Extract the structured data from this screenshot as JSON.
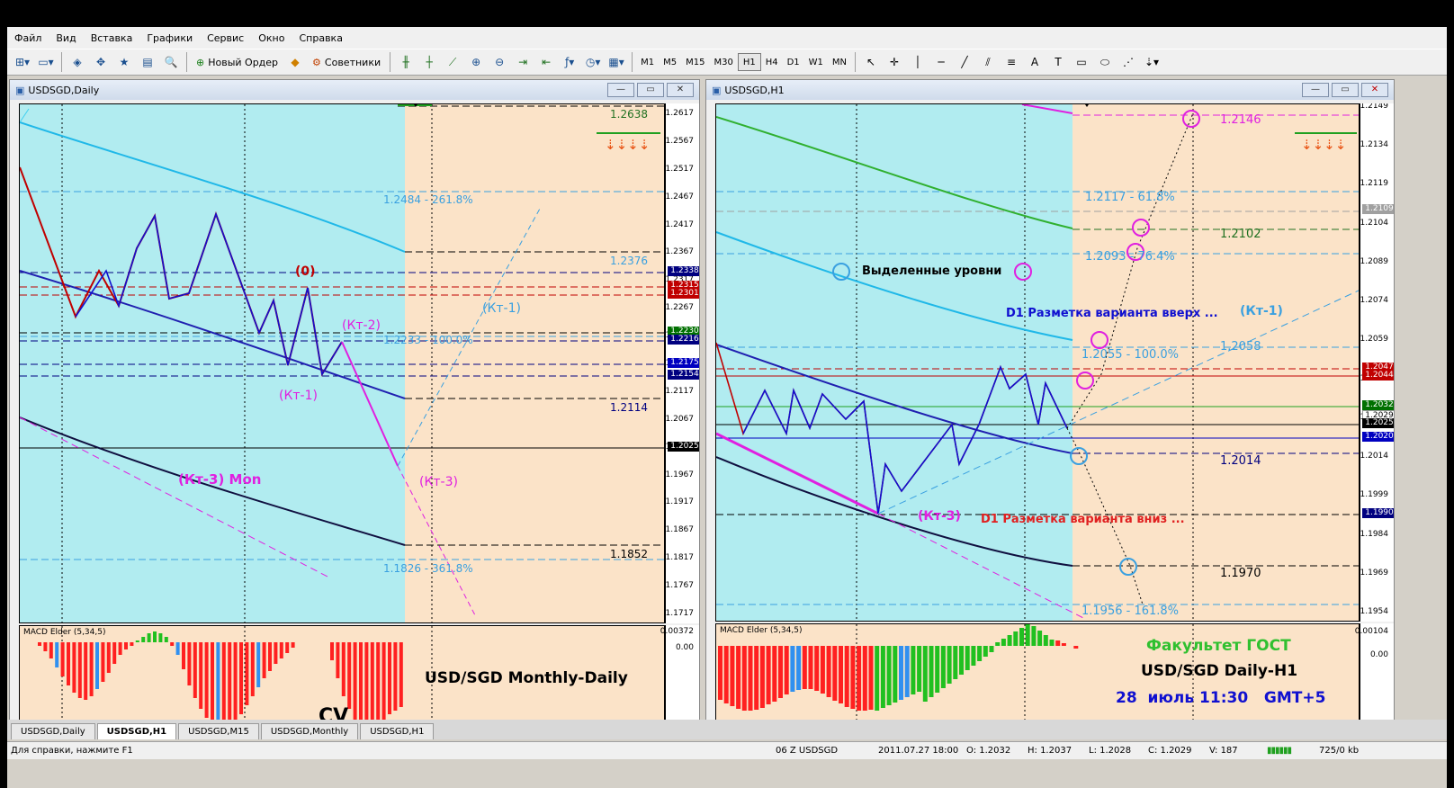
{
  "menu": [
    "Файл",
    "Вид",
    "Вставка",
    "Графики",
    "Сервис",
    "Окно",
    "Справка"
  ],
  "toolbar": {
    "new_order": "Новый Ордер",
    "experts": "Советники",
    "timeframes": [
      "M1",
      "M5",
      "M15",
      "M30",
      "H1",
      "H4",
      "D1",
      "W1",
      "MN"
    ],
    "active_timeframe": "H1"
  },
  "left_chart": {
    "title": "USDSGD,Daily",
    "price_ticks": [
      "1.2617",
      "1.2567",
      "1.2517",
      "1.2467",
      "1.2417",
      "1.2367",
      "1.2317",
      "1.2267",
      "1.2217",
      "1.2167",
      "1.2117",
      "1.2067",
      "1.2017",
      "1.1967",
      "1.1917",
      "1.1867",
      "1.1817",
      "1.1767",
      "1.1717"
    ],
    "price_tags": [
      {
        "text": "1.2338",
        "color": "#000080"
      },
      {
        "text": "1.2315",
        "color": "#c00000"
      },
      {
        "text": "1.2301",
        "color": "#c00000"
      },
      {
        "text": "1.2230",
        "color": "#007000"
      },
      {
        "text": "1.2216",
        "color": "#000080"
      },
      {
        "text": "1.2175",
        "color": "#0000c0"
      },
      {
        "text": "1.2154",
        "color": "#000080"
      },
      {
        "text": "1.2025",
        "color": "#000000"
      }
    ],
    "level_labels": {
      "l_2638": "1.2638",
      "l_2484": "1.2484 - 261.8%",
      "l_2376": "1.2376",
      "l_2233": "1.2233 - 100.0%",
      "l_2114": "1.2114",
      "l_1852": "1.1852",
      "l_1826": "1.1826 - 361.8%"
    },
    "annotations": {
      "zero": "(0)",
      "kt2": "(Кт-2)",
      "kt1_low": "(Кт-1)",
      "kt1_up": "(Кт-1)",
      "kt3": "(Кт-3)",
      "kt3_mon": "(Кт-3) Mon"
    },
    "macd_label": "MACD Elder (5,34,5)",
    "macd_ticks": [
      "0.00372",
      "0.00"
    ],
    "caption": "USD/SGD Monthly-Daily",
    "cv": "CV"
  },
  "right_chart": {
    "title": "USDSGD,H1",
    "price_ticks": [
      "1.2149",
      "1.2134",
      "1.2119",
      "1.2104",
      "1.2089",
      "1.2074",
      "1.2059",
      "1.2044",
      "1.2029",
      "1.2014",
      "1.1999",
      "1.1984",
      "1.1969",
      "1.1954"
    ],
    "price_tags": [
      {
        "text": "1.2109",
        "color": "#a0a0a0"
      },
      {
        "text": "1.2047",
        "color": "#c00000"
      },
      {
        "text": "1.2044",
        "color": "#c00000"
      },
      {
        "text": "1.2032",
        "color": "#007000"
      },
      {
        "text": "1.2029",
        "color": "#ffffff"
      },
      {
        "text": "1.2025",
        "color": "#000000"
      },
      {
        "text": "1.2020",
        "color": "#0000c0"
      },
      {
        "text": "1.1990",
        "color": "#000080"
      }
    ],
    "level_labels": {
      "l_2146": "1.2146",
      "l_2117": "1.2117 - 61.8%",
      "l_2102": "1.2102",
      "l_2093": "1.2093 - 76.4%",
      "l_2058": "1.2058",
      "l_2055": "1.2055 - 100.0%",
      "l_2014": "1.2014",
      "l_1970": "1.1970",
      "l_1956": "1.1956 - 161.8%"
    },
    "annotations": {
      "levels": "Выделенные уровни",
      "d1_up": "D1 Разметка варианта вверх ...",
      "kt1": "(Кт-1)",
      "kt3": "(Кт-3)",
      "d1_down": "D1 Разметка варианта вниз ..."
    },
    "macd_label": "MACD Elder (5,34,5)",
    "macd_ticks": [
      "0.00104",
      "0.00"
    ],
    "caption_1": "Факультет ГОСТ",
    "caption_2": "USD/SGD Daily-H1",
    "caption_3": "28  июль 11:30   GMT+5"
  },
  "tabs": [
    "USDSGD,Daily",
    "USDSGD,H1",
    "USDSGD,M15",
    "USDSGD,Monthly",
    "USDSGD,H1"
  ],
  "active_tab": 1,
  "status": {
    "help": "Для справки, нажмите F1",
    "profile": "06 Z USDSGD",
    "datetime": "2011.07.27 18:00",
    "open": "O: 1.2032",
    "high": "H: 1.2037",
    "low": "L: 1.2028",
    "close": "C: 1.2029",
    "volume": "V: 187",
    "traffic": "725/0 kb"
  },
  "colors": {
    "cyan_zone": "#b1ecf0",
    "peach_zone": "#fbe3c8",
    "zigzag_blue": "#1010d0",
    "zigzag_red": "#c00000",
    "magenta": "#e020e0",
    "macd_red": "#ff2020",
    "macd_green": "#20c020",
    "macd_blue": "#3090f0"
  }
}
